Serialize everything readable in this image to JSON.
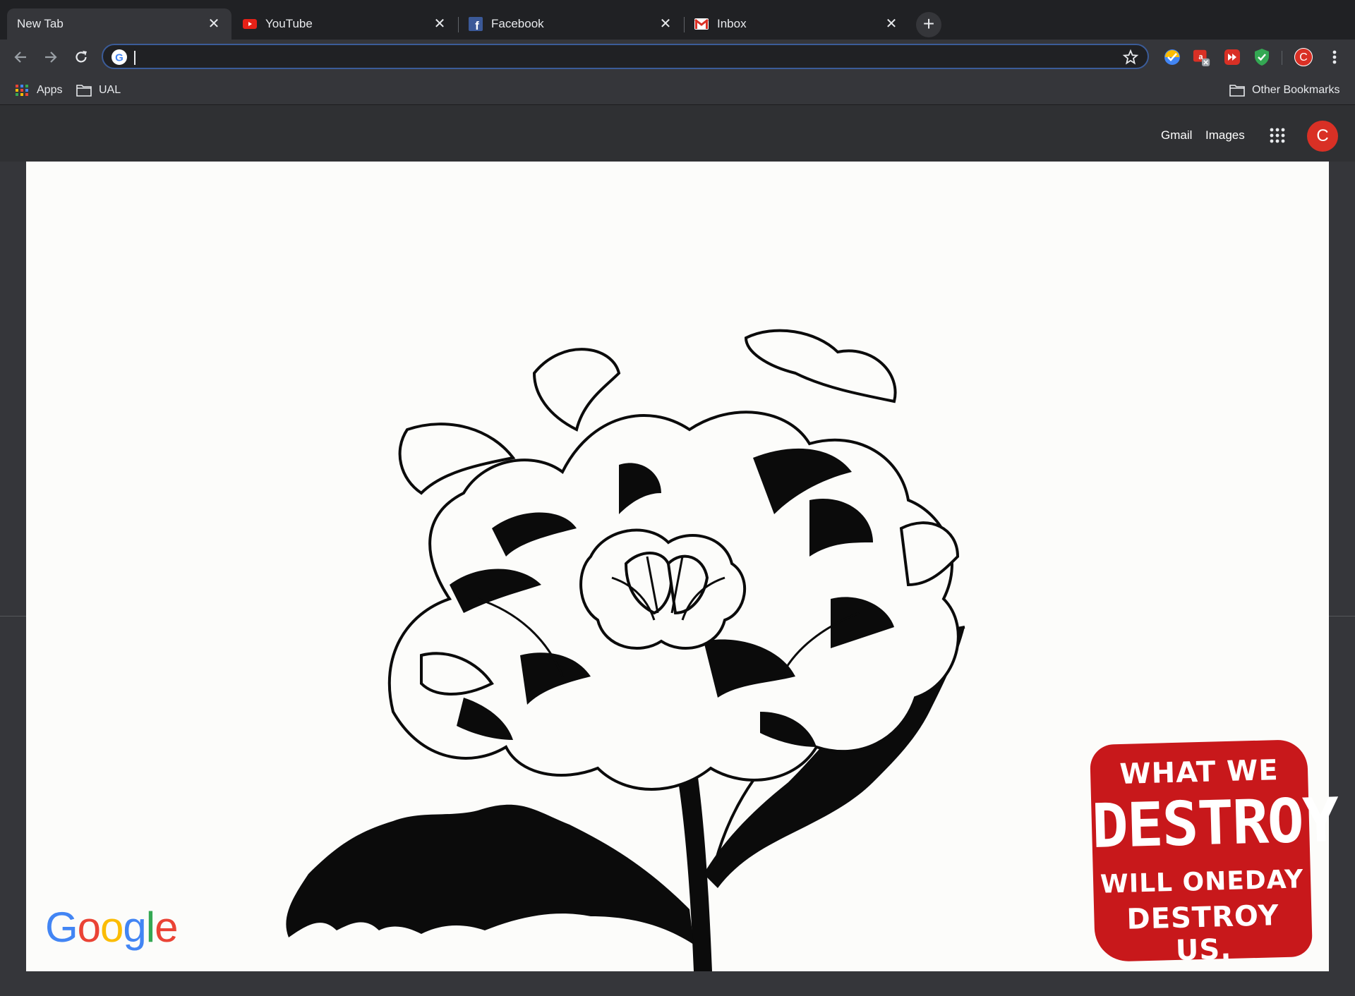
{
  "tabs": [
    {
      "title": "New Tab",
      "icon": "none",
      "active": true
    },
    {
      "title": "YouTube",
      "icon": "youtube-icon",
      "active": false
    },
    {
      "title": "Facebook",
      "icon": "facebook-icon",
      "active": false
    },
    {
      "title": "Inbox",
      "icon": "gmail-icon",
      "active": false
    }
  ],
  "toolbar": {
    "omnibox_value": "",
    "profile_initial": "C"
  },
  "bookmarks": {
    "apps": "Apps",
    "ual": "UAL",
    "other": "Other Bookmarks"
  },
  "ntp": {
    "gmail": "Gmail",
    "images": "Images",
    "avatar_initial": "C"
  },
  "wallpaper": {
    "sticker_line1": "WHAT WE",
    "sticker_line2": "DESTROY",
    "sticker_line3": "WILL ONEDAY",
    "sticker_line4": "DESTROY US."
  },
  "colors": {
    "accent_blue": "#3b5c99",
    "sticker_red": "#c8181b",
    "avatar_red": "#d93025"
  }
}
